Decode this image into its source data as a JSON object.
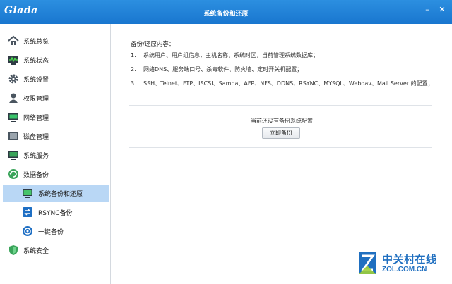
{
  "window": {
    "logo": "Giada",
    "title": "系统备份和还原",
    "minimize_glyph": "–",
    "close_glyph": "✕"
  },
  "sidebar": {
    "items": [
      {
        "label": "系统总览",
        "icon": "home-icon"
      },
      {
        "label": "系统状态",
        "icon": "monitor-pulse-icon"
      },
      {
        "label": "系统设置",
        "icon": "gear-icon"
      },
      {
        "label": "权限管理",
        "icon": "user-icon"
      },
      {
        "label": "网络管理",
        "icon": "network-icon"
      },
      {
        "label": "磁盘管理",
        "icon": "disk-icon"
      },
      {
        "label": "系统服务",
        "icon": "service-icon"
      },
      {
        "label": "数据备份",
        "icon": "backup-icon"
      },
      {
        "label": "系统备份和还原",
        "icon": "system-backup-icon",
        "active": true
      },
      {
        "label": "RSYNC备份",
        "icon": "rsync-icon"
      },
      {
        "label": "一键备份",
        "icon": "one-key-backup-icon"
      },
      {
        "label": "系统安全",
        "icon": "shield-icon"
      }
    ]
  },
  "content": {
    "heading": "备份/还原内容：",
    "items": [
      {
        "num": "1.",
        "text": "系统用户、用户组信息，主机名称，系统时区，当前管理系统数据库；"
      },
      {
        "num": "2.",
        "text": "网络DNS、服务端口号、杀毒软件、防火墙、定时开关机配置；"
      },
      {
        "num": "3.",
        "text": "SSH、Telnet、FTP、ISCSI、Samba、AFP、NFS、DDNS、RSYNC、MYSQL、Webdav、Mail Server 的配置；"
      }
    ],
    "status": "当前还没有备份系统配置",
    "backup_button": "立即备份"
  },
  "watermark": {
    "cn": "中关村在线",
    "en": "ZOL.COM.CN"
  },
  "colors": {
    "titlebar": "#1f7fd6",
    "active_item": "#b9d7f5",
    "watermark": "#1f6fc0"
  }
}
